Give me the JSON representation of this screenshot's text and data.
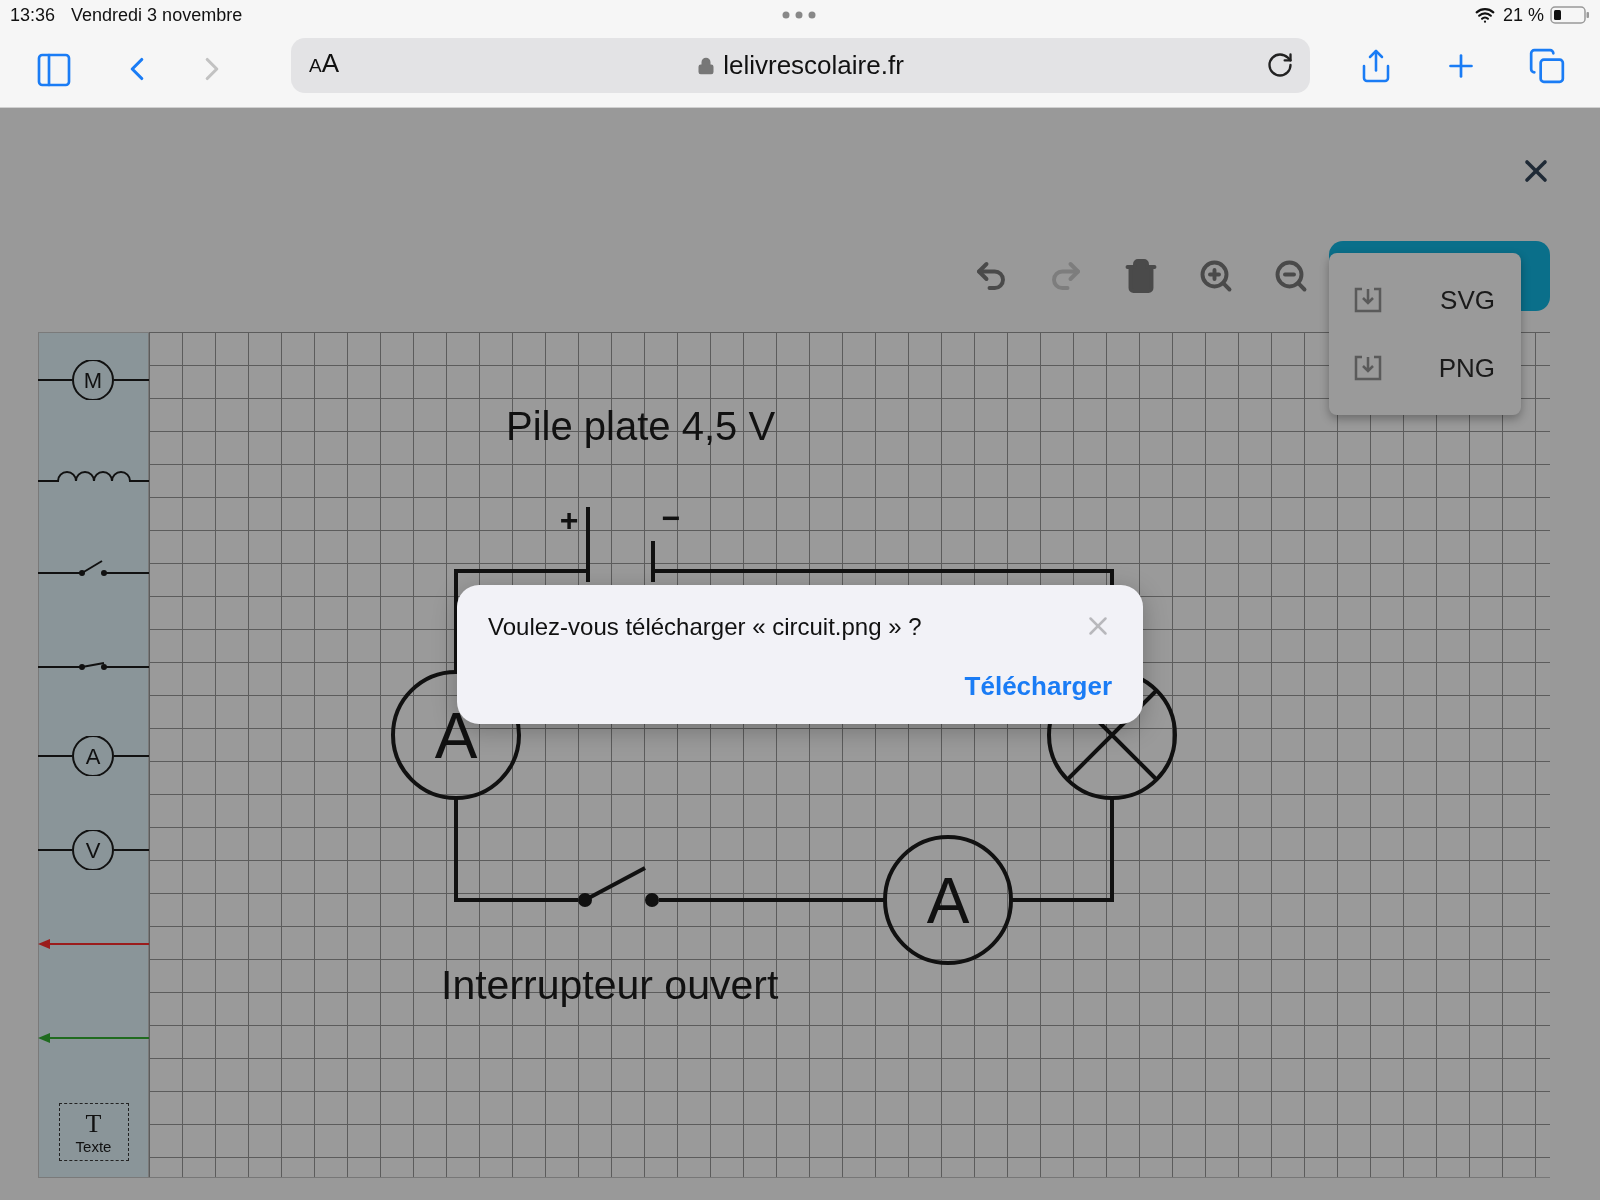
{
  "status_bar": {
    "time": "13:36",
    "date": "Vendredi 3 novembre",
    "battery": "21 %"
  },
  "browser": {
    "reader_button": "AA",
    "url": "lelivrescolaire.fr",
    "nav": [
      {
        "kind": "back",
        "disabled": false
      },
      {
        "kind": "forward",
        "disabled": true
      }
    ]
  },
  "toolbar": [
    {
      "kind": "undo",
      "disabled": false
    },
    {
      "kind": "redo",
      "disabled": true
    },
    {
      "kind": "delete",
      "disabled": false
    },
    {
      "kind": "zoom-in",
      "disabled": false
    },
    {
      "kind": "zoom-out",
      "disabled": false
    }
  ],
  "export_menu": {
    "items": [
      {
        "label": "SVG"
      },
      {
        "label": "PNG"
      }
    ]
  },
  "palette": [
    {
      "kind": "motor",
      "label": "M"
    },
    {
      "kind": "coil"
    },
    {
      "kind": "switch",
      "closed": false
    },
    {
      "kind": "switch",
      "closed": true
    },
    {
      "kind": "ammeter",
      "label": "A"
    },
    {
      "kind": "voltmeter",
      "label": "V"
    },
    {
      "kind": "arrow",
      "color": "#9b1c1c"
    },
    {
      "kind": "arrow",
      "color": "#1f6b1f"
    },
    {
      "kind": "text",
      "glyph": "T",
      "label": "Texte"
    }
  ],
  "circuit": {
    "labels": [
      {
        "text": "Pile plate 4,5 V"
      },
      {
        "text": "Interrupteur ouvert"
      }
    ],
    "battery": {
      "plus": "+",
      "minus": "−"
    },
    "components": [
      {
        "kind": "ammeter",
        "label": "A"
      },
      {
        "kind": "lamp"
      },
      {
        "kind": "switch",
        "closed": false
      },
      {
        "kind": "ammeter",
        "label": "A"
      }
    ]
  },
  "dialog": {
    "message": "Voulez-vous télécharger « circuit.png » ?",
    "action": "Télécharger"
  }
}
